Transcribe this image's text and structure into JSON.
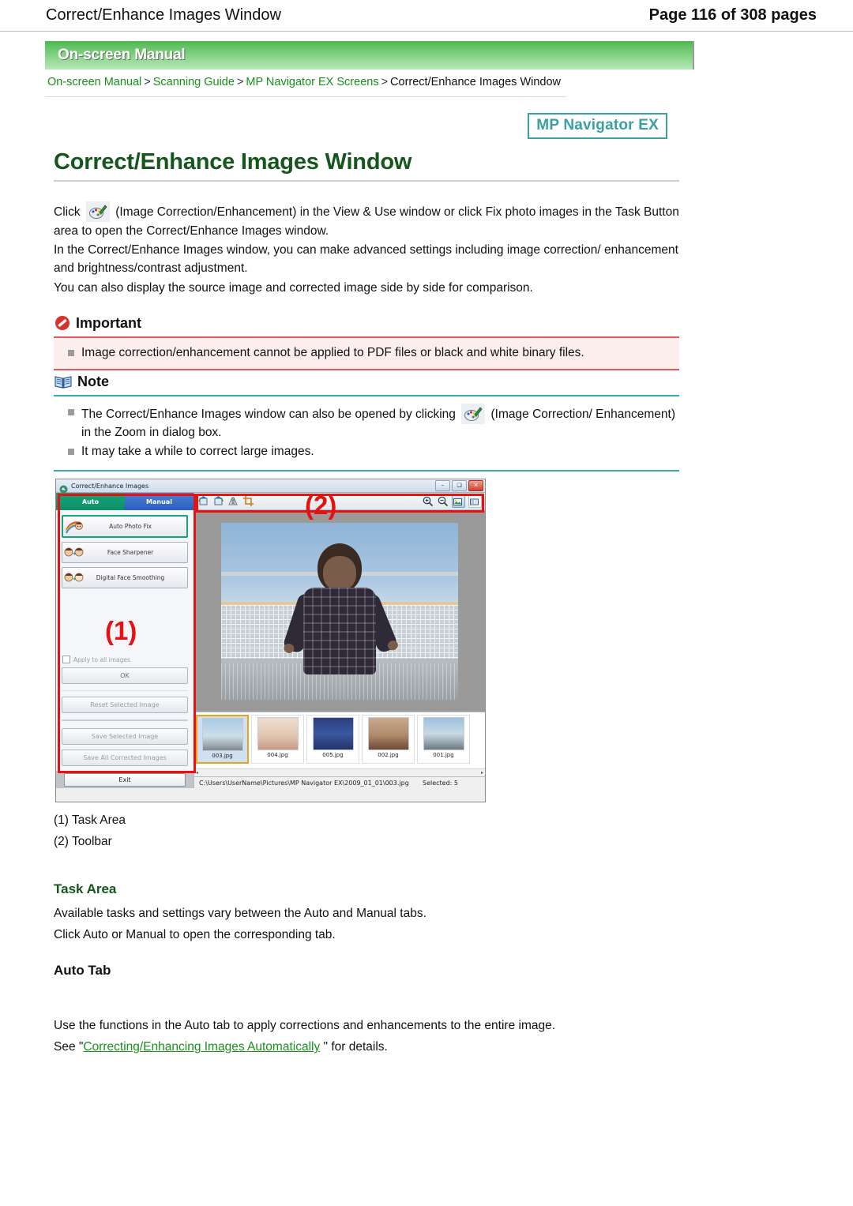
{
  "header": {
    "title": "Correct/Enhance Images Window",
    "page_label": "Page 116 of 308 pages"
  },
  "banner": {
    "label": "On-screen Manual"
  },
  "breadcrumb": {
    "items": [
      {
        "label": "On-screen Manual",
        "link": true
      },
      {
        "label": "Scanning Guide",
        "link": true
      },
      {
        "label": "MP Navigator EX Screens",
        "link": true
      },
      {
        "label": "Correct/Enhance Images Window",
        "link": false
      }
    ],
    "separator": ">"
  },
  "product_logo": {
    "label": "MP Navigator EX"
  },
  "doc": {
    "title": "Correct/Enhance Images Window",
    "para1_pre": "Click",
    "para1_post": "(Image Correction/Enhancement) in the View & Use window or click Fix photo images in the Task Button area to open the Correct/Enhance Images window.",
    "para2": "In the Correct/Enhance Images window, you can make advanced settings including image correction/ enhancement and brightness/contrast adjustment.",
    "para3": "You can also display the source image and corrected image side by side for comparison."
  },
  "important": {
    "heading": "Important",
    "items": [
      "Image correction/enhancement cannot be applied to PDF files or black and white binary files."
    ],
    "color": "#e05a5a"
  },
  "note": {
    "heading": "Note",
    "item1_pre": "The Correct/Enhance Images window can also be opened by clicking",
    "item1_post": "(Image Correction/ Enhancement) in the Zoom in dialog box.",
    "item2": "It may take a while to correct large images.",
    "color": "#3aa8a8"
  },
  "app": {
    "window_title": "Correct/Enhance Images",
    "window_buttons": {
      "minimize": "–",
      "maximize": "❑",
      "close": "✕"
    },
    "tabs": [
      {
        "label": "Auto",
        "active": true
      },
      {
        "label": "Manual",
        "active": false
      }
    ],
    "task_buttons": [
      {
        "label": "Auto Photo Fix",
        "selected": true
      },
      {
        "label": "Face Sharpener",
        "selected": false
      },
      {
        "label": "Digital Face Smoothing",
        "selected": false
      }
    ],
    "apply_all_label": "Apply to all images",
    "ok_label": "OK",
    "reset_label": "Reset Selected Image",
    "save_selected_label": "Save Selected Image",
    "save_all_label": "Save All Corrected Images",
    "exit_label": "Exit",
    "toolbar_icons": [
      "rotate-left-icon",
      "rotate-right-icon",
      "mirror-flip-icon",
      "crop-icon",
      "zoom-in-icon",
      "zoom-out-icon",
      "fit-to-window-icon",
      "compare-view-icon"
    ],
    "thumbnails": [
      {
        "label": "003.jpg",
        "selected": true
      },
      {
        "label": "004.jpg",
        "selected": false
      },
      {
        "label": "005.jpg",
        "selected": false
      },
      {
        "label": "002.jpg",
        "selected": false
      },
      {
        "label": "001.jpg",
        "selected": false
      }
    ],
    "status_path": "C:\\Users\\UserName\\Pictures\\MP Navigator EX\\2009_01_01\\003.jpg",
    "status_selected": "Selected: 5",
    "annotations": [
      {
        "number": "(1)",
        "target": "task-area"
      },
      {
        "number": "(2)",
        "target": "toolbar"
      }
    ],
    "scroll_left": "◂",
    "scroll_right": "▸"
  },
  "captions": {
    "item1": "(1) Task Area",
    "item2": "(2) Toolbar"
  },
  "sections": {
    "task_area_heading": "Task Area",
    "task_area_line1": "Available tasks and settings vary between the Auto and Manual tabs.",
    "task_area_line2": "Click Auto or Manual to open the corresponding tab.",
    "auto_tab_heading": "Auto Tab",
    "auto_tab_line1": "Use the functions in the Auto tab to apply corrections and enhancements to the entire image.",
    "auto_tab_see_pre": "See \"",
    "auto_tab_link": "Correcting/Enhancing Images Automatically",
    "auto_tab_see_post": " \" for details."
  }
}
